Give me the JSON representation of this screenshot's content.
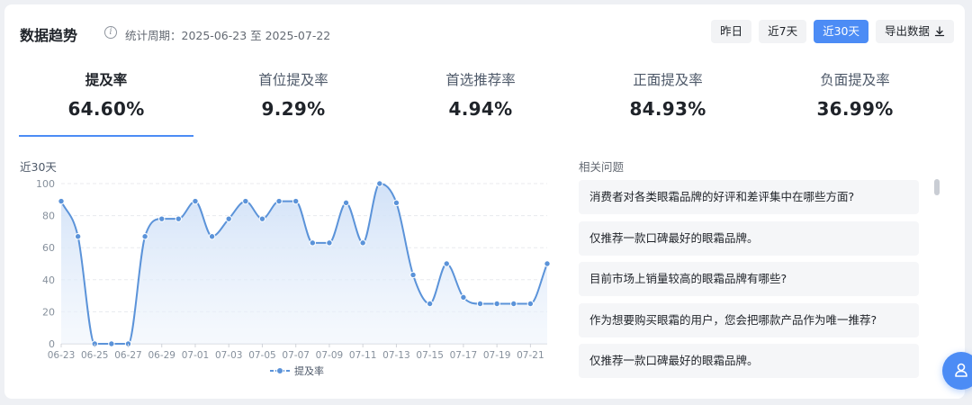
{
  "header": {
    "title": "数据趋势",
    "info_icon": "info-icon",
    "period": "统计周期：2025-06-23 至 2025-07-22"
  },
  "buttons": {
    "yesterday": "昨日",
    "last7": "近7天",
    "last30": "近30天",
    "export": "导出数据",
    "export_icon": "download-icon",
    "active": "last30"
  },
  "metrics": [
    {
      "label": "提及率",
      "value": "64.60%",
      "active": true
    },
    {
      "label": "首位提及率",
      "value": "9.29%",
      "active": false
    },
    {
      "label": "首选推荐率",
      "value": "4.94%",
      "active": false
    },
    {
      "label": "正面提及率",
      "value": "84.93%",
      "active": false
    },
    {
      "label": "负面提及率",
      "value": "36.99%",
      "active": false
    }
  ],
  "chart": {
    "title": "近30天"
  },
  "chart_data": {
    "type": "area",
    "x": [
      "06-23",
      "06-24",
      "06-25",
      "06-26",
      "06-27",
      "06-28",
      "06-29",
      "06-30",
      "07-01",
      "07-02",
      "07-03",
      "07-04",
      "07-05",
      "07-06",
      "07-07",
      "07-08",
      "07-09",
      "07-10",
      "07-11",
      "07-12",
      "07-13",
      "07-14",
      "07-15",
      "07-16",
      "07-17",
      "07-18",
      "07-19",
      "07-20",
      "07-21",
      "07-22"
    ],
    "tick_labels": [
      "06-23",
      "06-25",
      "06-27",
      "06-29",
      "07-01",
      "07-03",
      "07-05",
      "07-07",
      "07-09",
      "07-11",
      "07-13",
      "07-15",
      "07-17",
      "07-19",
      "07-21"
    ],
    "series": [
      {
        "name": "提及率",
        "values": [
          89,
          67,
          0,
          0,
          0,
          67,
          78,
          78,
          89,
          67,
          78,
          89,
          78,
          89,
          89,
          63,
          63,
          88,
          63,
          100,
          88,
          43,
          25,
          50,
          29,
          25,
          25,
          25,
          25,
          50
        ]
      }
    ],
    "ylim": [
      0,
      100
    ],
    "yticks": [
      0,
      20,
      40,
      60,
      80,
      100
    ],
    "grid": true,
    "legend": "bottom-center",
    "line_color": "#5b93d9",
    "fill_color": "#e3edfa"
  },
  "related": {
    "title": "相关问题",
    "questions": [
      "消费者对各类眼霜品牌的好评和差评集中在哪些方面?",
      "仅推荐一款口碑最好的眼霜品牌。",
      "目前市场上销量较高的眼霜品牌有哪些?",
      "作为想要购买眼霜的用户，您会把哪款产品作为唯一推荐?",
      "仅推荐一款口碑最好的眼霜品牌。"
    ]
  },
  "float_button": {
    "icon": "user-icon"
  },
  "colors": {
    "accent": "#4c8cf5",
    "chart_line": "#5b93d9"
  }
}
